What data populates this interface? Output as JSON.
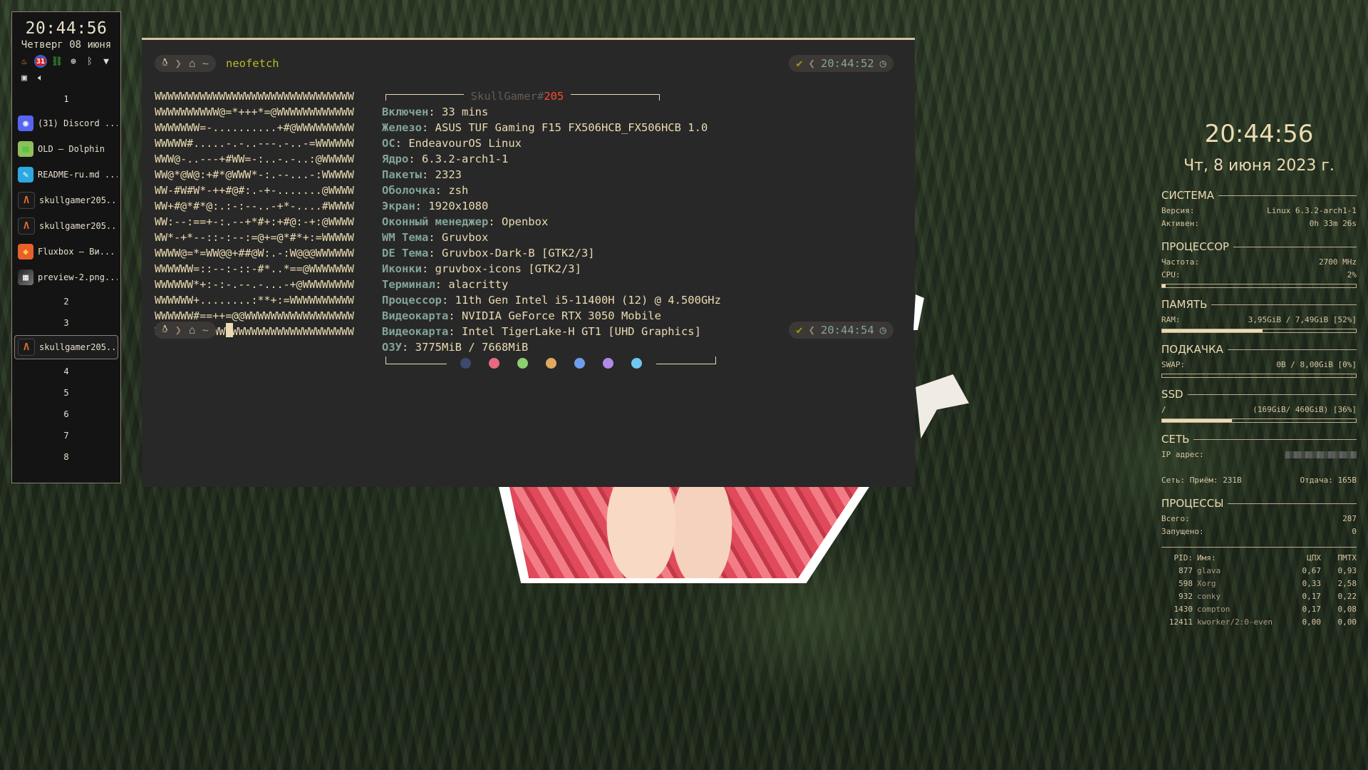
{
  "panel": {
    "time": "20:44:56",
    "date": "Четверг 08 июня",
    "tray_icons": [
      "fire-icon",
      "calendar-icon",
      "network-icon",
      "steam-icon",
      "bluetooth-icon",
      "wifi-icon",
      "clipboard-icon",
      "volume-icon"
    ],
    "calendar_day": "31",
    "workspaces": [
      {
        "label": "1",
        "tasks": [
          {
            "label": "(31) Discord ...",
            "icon": "discord-icon"
          },
          {
            "label": "OLD — Dolphin",
            "icon": "dolphin-icon"
          },
          {
            "label": "README-ru.md ...",
            "icon": "markdown-icon"
          },
          {
            "label": "skullgamer205...",
            "icon": "alacritty-icon"
          },
          {
            "label": "skullgamer205...",
            "icon": "alacritty-icon"
          },
          {
            "label": "Fluxbox — Ви...",
            "icon": "firefox-icon"
          },
          {
            "label": "preview-2.png...",
            "icon": "image-icon"
          }
        ]
      },
      {
        "label": "2",
        "tasks": []
      },
      {
        "label": "3",
        "tasks": [
          {
            "label": "skullgamer205...",
            "icon": "alacritty-icon",
            "active": true
          }
        ]
      },
      {
        "label": "4",
        "tasks": []
      },
      {
        "label": "5",
        "tasks": []
      },
      {
        "label": "6",
        "tasks": []
      },
      {
        "label": "7",
        "tasks": []
      },
      {
        "label": "8",
        "tasks": []
      }
    ]
  },
  "terminal": {
    "prompt_home": "~",
    "command": "neofetch",
    "status_ok": "✔",
    "time1": "20:44:52",
    "time2": "20:44:54",
    "ascii": [
      "WWWWWWWWWWWWWWWWWWWWWWWWWWWWWWW",
      "WWWWWWWWWW@=*+++*=@WWWWWWWWWWWW",
      "WWWWWWW=-..........+#@WWWWWWWWW",
      "WWWWW#.....-.-..---.-..-=WWWWWW",
      "WWW@-..---+#WW=-:..-.-..:@WWWWW",
      "WW@*@W@:+#*@WWW*-:.--...-:WWWWW",
      "WW-#W#W*-++#@#:.-+-.......@WWWW",
      "WW+#@*#*@:.:-:--..-+*-....#WWWW",
      "WW:--:==+-:.--+*#+:+#@:-+:@WWWW",
      "WW*-+*--::-:--:=@+=@*#*+:=WWWWW",
      "WWWW@=*=WW@@+##@W:.-:W@@@WWWWWW",
      "WWWWWW=::--:-::-#*..*==@WWWWWWW",
      "WWWWWW*+:-:-.--.-...-+@WWWWWWWW",
      "WWWWWW+........:**+:=WWWWWWWWWW",
      "WWWWWW#==++=@@WWWWWWWWWWWWWWWWW",
      "WWWWWWWWWWWWWWWWWWWWWWWWWWWWWWW"
    ],
    "header_user": "SkullGamer#",
    "header_num": "205",
    "info": [
      {
        "k": "Включен",
        "v": "33 mins"
      },
      {
        "k": "Железо",
        "v": "ASUS TUF Gaming F15 FX506HCB_FX506HCB 1.0"
      },
      {
        "k": "ОС",
        "v": "EndeavourOS Linux"
      },
      {
        "k": "Ядро",
        "v": "6.3.2-arch1-1"
      },
      {
        "k": "Пакеты",
        "v": "2323"
      },
      {
        "k": "Оболочка",
        "v": "zsh"
      },
      {
        "k": "Экран",
        "v": "1920x1080"
      },
      {
        "k": "Оконный менеджер",
        "v": "Openbox"
      },
      {
        "k": "WM Тема",
        "v": "Gruvbox"
      },
      {
        "k": "DE Тема",
        "v": "Gruvbox-Dark-B [GTK2/3]"
      },
      {
        "k": "Иконки",
        "v": "gruvbox-icons [GTK2/3]"
      },
      {
        "k": "Терминал",
        "v": "alacritty"
      },
      {
        "k": "Процессор",
        "v": "11th Gen Intel i5-11400H (12) @ 4.500GHz"
      },
      {
        "k": "Видеокарта",
        "v": "NVIDIA GeForce RTX 3050 Mobile"
      },
      {
        "k": "Видеокарта",
        "v": "Intel TigerLake-H GT1 [UHD Graphics]"
      },
      {
        "k": "ОЗУ",
        "v": "3775MiB / 7668MiB"
      }
    ],
    "palette": [
      "#3c4a6e",
      "#e8697e",
      "#8ccf6e",
      "#e0a860",
      "#6e9ef0",
      "#b08ae8",
      "#6ec8f0"
    ]
  },
  "conky": {
    "time": "20:44:56",
    "date": "Чт, 8 июня 2023 г.",
    "system": {
      "title": "СИСТЕМА",
      "version_label": "Версия:",
      "version": "Linux 6.3.2-arch1-1",
      "uptime_label": "Активен:",
      "uptime": "0h 33m 26s"
    },
    "cpu": {
      "title": "ПРОЦЕССОР",
      "freq_label": "Частота:",
      "freq": "2700 MHz",
      "cpu_label": "CPU:",
      "cpu": "2%",
      "usage": 0.02
    },
    "mem": {
      "title": "ПАМЯТЬ",
      "ram_label": "RAM:",
      "ram": "3,95GiB / 7,49GiB [52%]",
      "usage": 0.52
    },
    "swap": {
      "title": "ПОДКАЧКА",
      "swap_label": "SWAP:",
      "swap": "0B / 8,00GiB [0%]",
      "usage": 0.0
    },
    "ssd": {
      "title": "SSD",
      "mount": "/",
      "value": "(169GiB/ 460GiB) [36%]",
      "usage": 0.36
    },
    "net": {
      "title": "СЕТЬ",
      "ip_label": "IP адрес:",
      "recv_label": "Сеть: Приём:",
      "recv": "231B",
      "send_label": "Отдача:",
      "send": "165B"
    },
    "proc": {
      "title": "ПРОЦЕССЫ",
      "total_label": "Всего:",
      "total": "287",
      "running_label": "Запущено:",
      "running": "0"
    },
    "ptable": {
      "headers": [
        "PID:",
        "Имя:",
        "ЦПХ",
        "ПМТХ"
      ],
      "rows": [
        [
          "877",
          "glava",
          "0,67",
          "0,93"
        ],
        [
          "598",
          "Xorg",
          "0,33",
          "2,58"
        ],
        [
          "932",
          "conky",
          "0,17",
          "0,22"
        ],
        [
          "1430",
          "compton",
          "0,17",
          "0,08"
        ],
        [
          "12411",
          "kworker/2:0-even",
          "0,00",
          "0,00"
        ]
      ]
    }
  }
}
